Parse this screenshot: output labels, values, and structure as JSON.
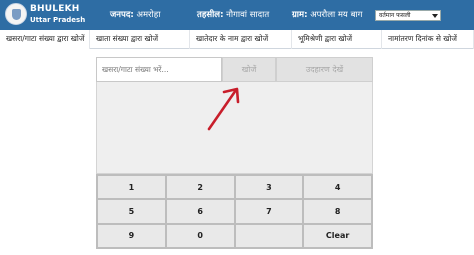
{
  "header": {
    "brand_title": "BHULEKH",
    "brand_subtitle": "Uttar Pradesh",
    "district_label": "जनपद:",
    "district_value": "अमरोहा",
    "tehsil_label": "तहसील:",
    "tehsil_value": "नौगावां सादात",
    "village_label": "ग्राम:",
    "village_value": "अपरौला मय बाग",
    "fasli_selected": "वर्तमान फसली",
    "colors": {
      "bar": "#2e6da4",
      "text": "#ffffff"
    }
  },
  "tabs": [
    {
      "label": "खसरा/गाटा संख्या द्वारा खोजें",
      "active": true
    },
    {
      "label": "खाता संख्या द्वारा खोजें"
    },
    {
      "label": "खातेदार के नाम द्वारा खोजें"
    },
    {
      "label": "भूमिश्रेणी द्वारा खोजें"
    },
    {
      "label": "नामांतरण दिनांक से खोजें"
    }
  ],
  "search": {
    "placeholder": "खसरा/गाटा संख्या भरें...",
    "search_label": "खोजें",
    "example_label": "उदहारण देखें"
  },
  "annotation": {
    "arrow_color": "#c81e2b"
  },
  "keypad": {
    "keys": [
      "1",
      "2",
      "3",
      "4",
      "5",
      "6",
      "7",
      "8",
      "9",
      "0",
      "",
      "Clear"
    ]
  }
}
